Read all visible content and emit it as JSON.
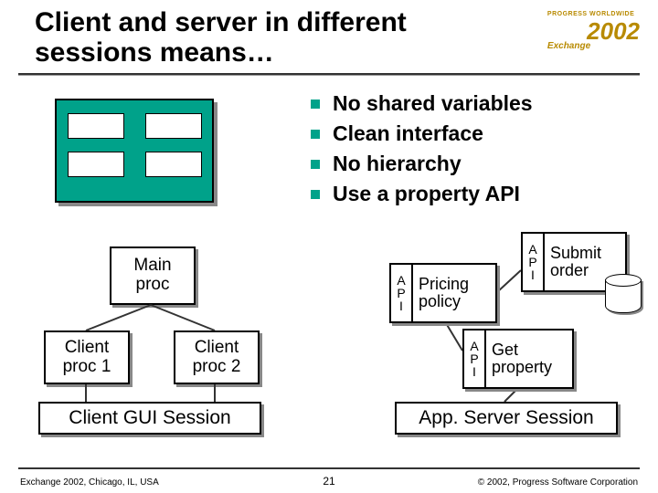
{
  "title": "Client and server in different sessions means…",
  "brand": {
    "small": "PROGRESS WORLDWIDE",
    "exchange": "Exchange",
    "year": "2002"
  },
  "bullets": [
    "No shared variables",
    "Clean interface",
    "No hierarchy",
    "Use a property API"
  ],
  "client": {
    "main": {
      "l1": "Main",
      "l2": "proc"
    },
    "proc1": {
      "l1": "Client",
      "l2": "proc 1"
    },
    "proc2": {
      "l1": "Client",
      "l2": "proc 2"
    },
    "session": "Client GUI Session"
  },
  "server": {
    "api_side": {
      "a": "A",
      "p": "P",
      "i": "I"
    },
    "pricing": {
      "l1": "Pricing",
      "l2": "policy"
    },
    "submit": {
      "l1": "Submit",
      "l2": "order"
    },
    "getprop": {
      "l1": "Get",
      "l2": "property"
    },
    "session": "App. Server Session"
  },
  "footer": {
    "left": "Exchange 2002, Chicago, IL, USA",
    "page": "21",
    "right": "© 2002, Progress Software Corporation"
  }
}
